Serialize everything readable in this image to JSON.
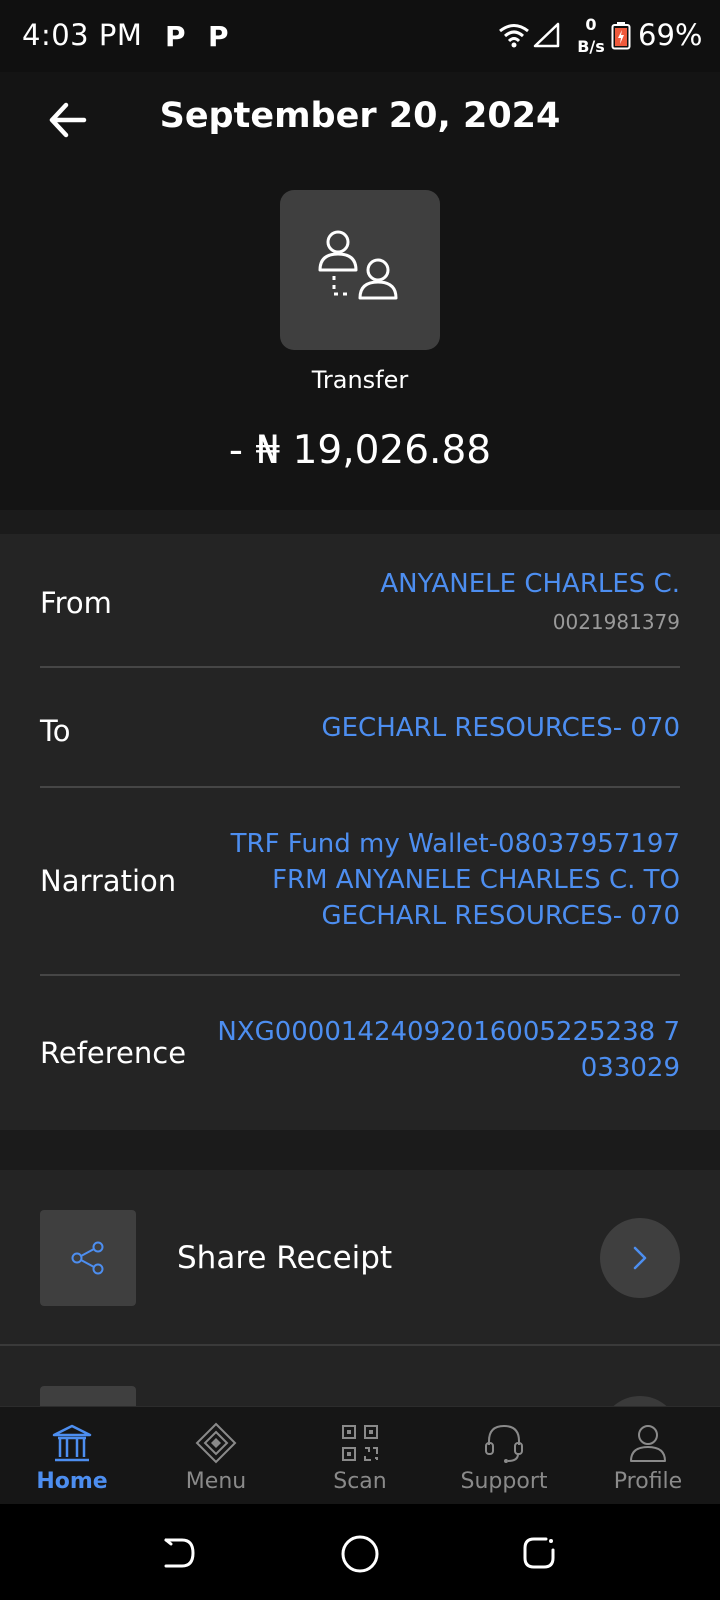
{
  "status_bar": {
    "time": "4:03 PM",
    "notif_icons": [
      "P",
      "P"
    ],
    "speed_value": "0",
    "speed_unit": "B/s",
    "battery": "69%"
  },
  "header": {
    "title": "September 20, 2024",
    "type_icon": "transfer-users-icon",
    "type_label": "Transfer",
    "amount": "- ₦ 19,026.88"
  },
  "details": [
    {
      "label": "From",
      "value": "ANYANELE CHARLES C.",
      "sub": "0021981379"
    },
    {
      "label": "To",
      "value": "GECHARL RESOURCES- 070"
    },
    {
      "label": "Narration",
      "lines": [
        "TRF Fund my Wallet-08037957197",
        "FRM ANYANELE CHARLES C. TO",
        "GECHARL RESOURCES- 070"
      ]
    },
    {
      "label": "Reference",
      "lines": [
        "NXG00001424092016005225238 7",
        "033029"
      ]
    }
  ],
  "actions": {
    "share_label": "Share Receipt",
    "share_icon": "share-icon",
    "go_icon": "chevron-right-icon"
  },
  "bottom_nav": [
    {
      "label": "Home",
      "icon": "bank-icon",
      "active": true
    },
    {
      "label": "Menu",
      "icon": "menu-diamond-icon",
      "active": false
    },
    {
      "label": "Scan",
      "icon": "qr-scan-icon",
      "active": false
    },
    {
      "label": "Support",
      "icon": "headset-icon",
      "active": false
    },
    {
      "label": "Profile",
      "icon": "profile-icon",
      "active": false
    }
  ],
  "colors": {
    "accent": "#4d8ef0",
    "background": "#1b1b1b",
    "card": "#242424",
    "tile": "#3f3f3f"
  }
}
